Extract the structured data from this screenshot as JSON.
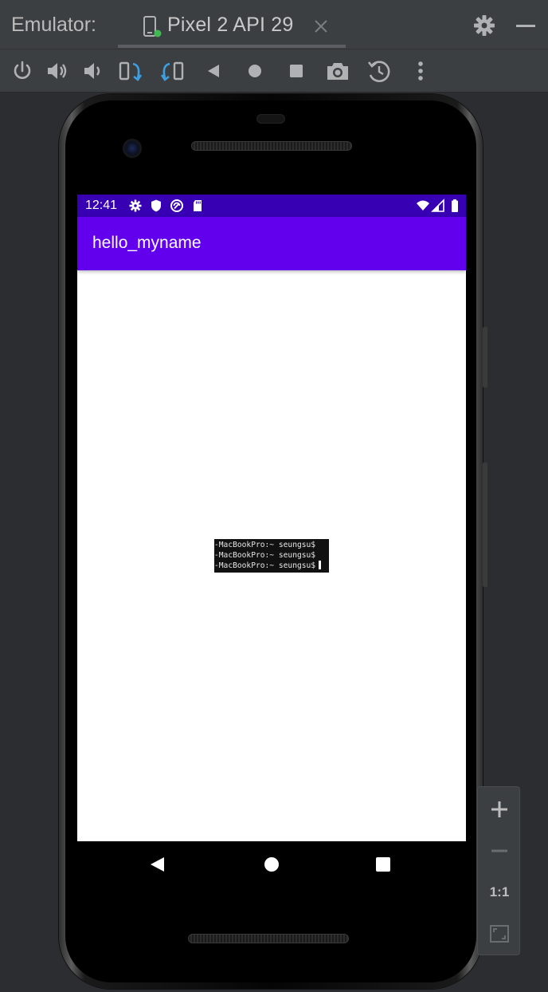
{
  "window": {
    "label": "Emulator:",
    "tab_title": "Pixel 2 API 29"
  },
  "toolbar": {
    "buttons": [
      {
        "name": "power-button",
        "icon": "power-icon"
      },
      {
        "name": "volume-up-button",
        "icon": "volume-up-icon"
      },
      {
        "name": "volume-down-button",
        "icon": "volume-down-icon"
      },
      {
        "name": "rotate-left-button",
        "icon": "rotate-left-icon"
      },
      {
        "name": "rotate-right-button",
        "icon": "rotate-right-icon"
      },
      {
        "name": "back-button",
        "icon": "back-triangle-icon"
      },
      {
        "name": "home-button",
        "icon": "home-circle-icon"
      },
      {
        "name": "overview-button",
        "icon": "overview-square-icon"
      },
      {
        "name": "screenshot-button",
        "icon": "camera-icon"
      },
      {
        "name": "snapshot-button",
        "icon": "snapshot-icon"
      },
      {
        "name": "more-button",
        "icon": "more-vertical-icon"
      }
    ]
  },
  "device": {
    "status_time": "12:41",
    "app_title": "hello_myname",
    "terminal_lines": [
      "-MacBookPro:~ seungsu$",
      "-MacBookPro:~ seungsu$",
      "-MacBookPro:~ seungsu$"
    ]
  },
  "zoom": {
    "one_to_one": "1:1"
  },
  "colors": {
    "status_bar": "#3700b3",
    "app_bar": "#6200ee",
    "ide_background": "#2b2d30",
    "ide_toolbar": "#3c3f41"
  }
}
